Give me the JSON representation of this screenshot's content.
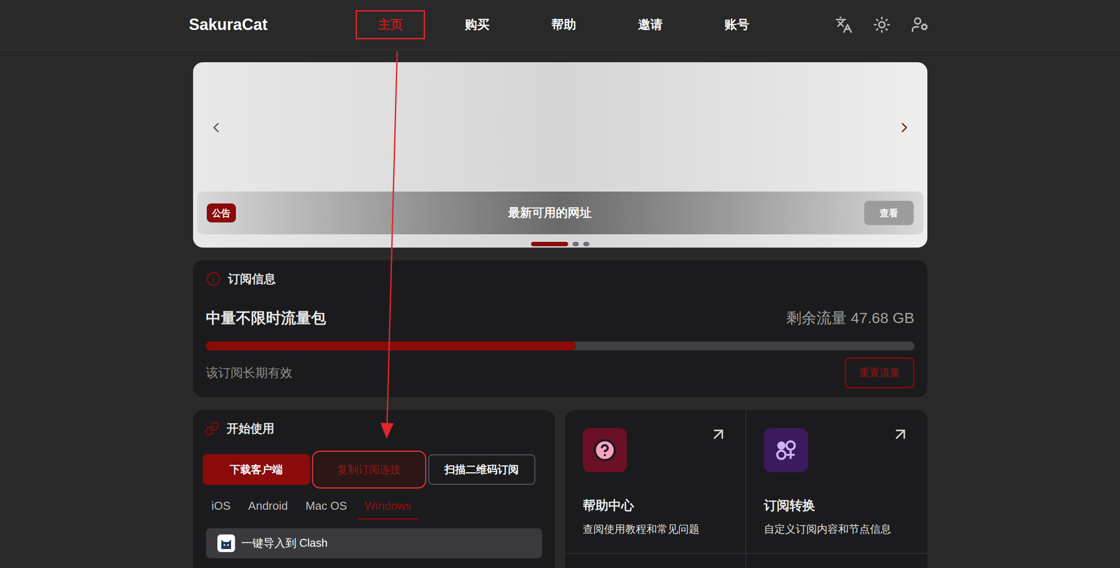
{
  "header": {
    "logo": "SakuraCat",
    "nav": [
      {
        "label": "主页",
        "selected": true,
        "highlighted": true
      },
      {
        "label": "购买",
        "selected": false,
        "highlighted": false
      },
      {
        "label": "帮助",
        "selected": false,
        "highlighted": false
      },
      {
        "label": "邀请",
        "selected": false,
        "highlighted": false
      },
      {
        "label": "账号",
        "selected": false,
        "highlighted": false
      }
    ]
  },
  "banner": {
    "badge": "公告",
    "title": "最新可用的网址",
    "button": "查看",
    "slides": [
      {
        "selected": true
      },
      {
        "selected": false
      },
      {
        "selected": false
      }
    ]
  },
  "subscription": {
    "title": "订阅信息",
    "plan": "中量不限时流量包",
    "remaining": "剩余流量 47.68 GB",
    "level": 0.523,
    "validity": "该订阅长期有效",
    "reset_button": "重置流量"
  },
  "start": {
    "title": "开始使用",
    "buttons": [
      {
        "label": "下载客户端",
        "kind": "primary",
        "highlighted": false
      },
      {
        "label": "复制订阅连接",
        "kind": "secondary",
        "highlighted": true
      },
      {
        "label": "扫描二维码订阅",
        "kind": "outline",
        "highlighted": false
      }
    ],
    "platforms": [
      {
        "label": "iOS",
        "selected": false
      },
      {
        "label": "Android",
        "selected": false
      },
      {
        "label": "Mac OS",
        "selected": false
      },
      {
        "label": "Windows",
        "selected": true
      }
    ],
    "import_items": [
      {
        "label": "一键导入到 Clash"
      }
    ]
  },
  "tiles": [
    {
      "title": "帮助中心",
      "description": "查阅使用教程和常见问题",
      "color": "#6b0f24"
    },
    {
      "title": "订阅转换",
      "description": "自定义订阅内容和节点信息",
      "color": "#3b1a5e"
    }
  ],
  "annotation": {
    "arrow": true
  }
}
